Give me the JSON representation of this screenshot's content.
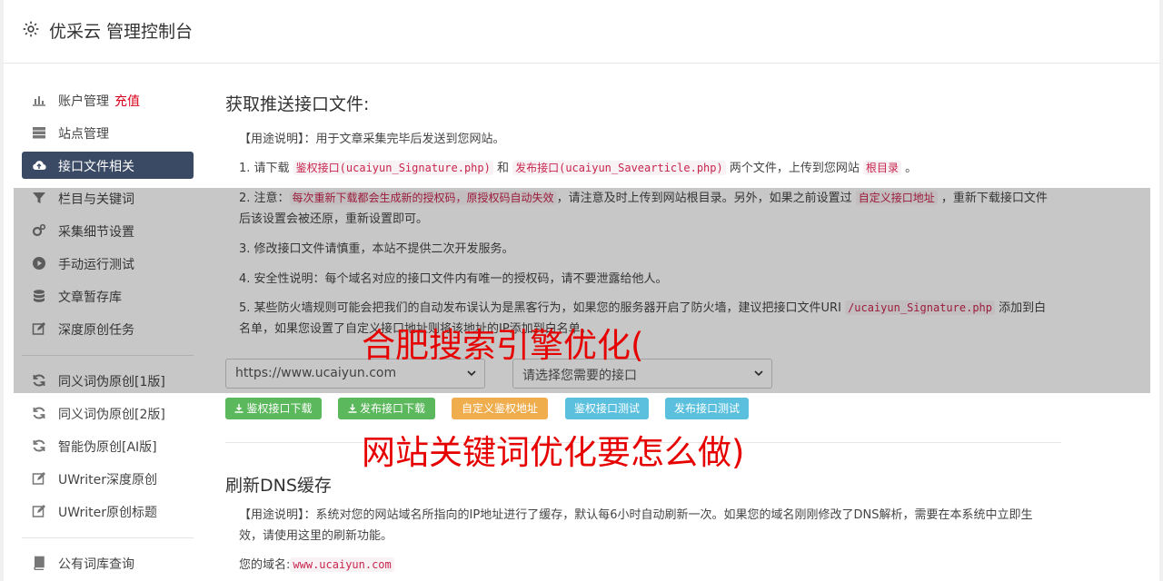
{
  "header": {
    "title": "优采云 管理控制台",
    "icon": "gear-icon"
  },
  "sidebar": {
    "items": [
      {
        "label": "账户管理",
        "badge": "充值",
        "icon": "bar-chart-icon"
      },
      {
        "label": "站点管理",
        "icon": "server-icon"
      },
      {
        "label": "接口文件相关",
        "icon": "cloud-upload-icon",
        "active": true
      },
      {
        "label": "栏目与关键词",
        "icon": "filter-icon"
      },
      {
        "label": "采集细节设置",
        "icon": "cogs-icon"
      },
      {
        "label": "手动运行测试",
        "icon": "play-circle-icon"
      },
      {
        "label": "文章暂存库",
        "icon": "database-icon"
      },
      {
        "label": "深度原创任务",
        "icon": "edit-icon"
      },
      {
        "label": "同义词伪原创[1版]",
        "icon": "refresh-icon"
      },
      {
        "label": "同义词伪原创[2版]",
        "icon": "refresh-icon"
      },
      {
        "label": "智能伪原创[AI版]",
        "icon": "refresh-icon"
      },
      {
        "label": "UWriter深度原创",
        "icon": "edit-icon"
      },
      {
        "label": "UWriter原创标题",
        "icon": "edit-icon"
      },
      {
        "label": "公有词库查询",
        "icon": "book-icon"
      }
    ]
  },
  "section1": {
    "title": "获取推送接口文件:",
    "usage_label": "【用途说明】",
    "usage_text": "：用于文章采集完毕后发送到您网站。",
    "p1_a": "1. 请下载 ",
    "p1_code1": "鉴权接口(ucaiyun_Signature.php)",
    "p1_b": " 和 ",
    "p1_code2": "发布接口(ucaiyun_Savearticle.php)",
    "p1_c": " 两个文件，上传到您网站 ",
    "p1_code3": "根目录",
    "p1_d": " 。",
    "p2_a": "2. 注意：",
    "p2_code1": "每次重新下载都会生成新的授权码，原授权码自动失效",
    "p2_b": "，请注意及时上传到网站根目录。另外，如果之前设置过 ",
    "p2_code2": "自定义接口地址",
    "p2_c": " ，重新下载接口文件后该设置会被还原，重新设置即可。",
    "p3": "3. 修改接口文件请慎重，本站不提供二次开发服务。",
    "p4": "4. 安全性说明：每个域名对应的接口文件内有唯一的授权码，请不要泄露给他人。",
    "p5_a": "5. 某些防火墙规则可能会把我们的自动发布误认为是黑客行为，如果您的服务器开启了防火墙，建议把接口文件URI ",
    "p5_code": "/ucaiyun_Signature.php",
    "p5_b": " 添加到白名单，如果您设置了自定义接口地址则将该地址的IP添加到白名单。",
    "select_domain": "https://www.ucaiyun.com",
    "select_interface": "请选择您需要的接口",
    "buttons": {
      "auth_download": "鉴权接口下载",
      "publish_download": "发布接口下载",
      "custom_auth": "自定义鉴权地址",
      "auth_test": "鉴权接口测试",
      "publish_test": "发布接口测试"
    }
  },
  "section2": {
    "title": "刷新DNS缓存",
    "usage_label": "【用途说明】",
    "usage_text": "：系统对您的网站域名所指向的IP地址进行了缓存，默认每6小时自动刷新一次。如果您的域名刚刚修改了DNS解析，需要在本系统中立即生效，请使用这里的刷新功能。",
    "domain_label": "您的域名:",
    "domain_value": "www.ucaiyun.com"
  },
  "watermark": {
    "line1": "合肥搜索引擎优化(",
    "line2": "网站关键词优化要怎么做)"
  },
  "colors": {
    "sidebar_active": "#3a4a64",
    "badge": "#d9001b",
    "code": "#c7254e",
    "watermark": "#e60000"
  }
}
